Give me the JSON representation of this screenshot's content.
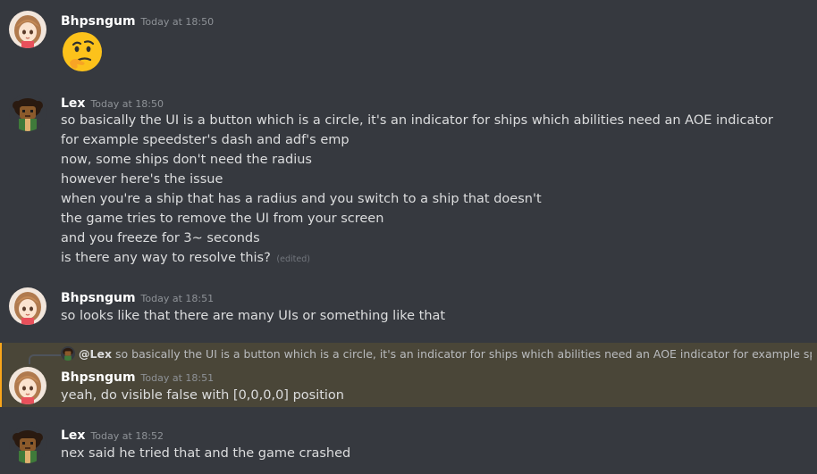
{
  "messages": [
    {
      "author": "Bhpsngum",
      "timestamp": "Today at 18:50",
      "emoji": "thinking-face"
    },
    {
      "author": "Lex",
      "timestamp": "Today at 18:50",
      "lines": [
        "so basically the UI is a button which is a circle, it's an indicator for ships which abilities need an AOE indicator",
        "for example speedster's dash and adf's emp",
        "now, some ships don't need the radius",
        "however here's the issue",
        "when you're a ship that has a radius and you switch to a ship that doesn't",
        "the game tries to remove the UI from your screen",
        "and you freeze for 3~ seconds",
        "is there any way to resolve this?"
      ],
      "edited_label": "(edited)"
    },
    {
      "author": "Bhpsngum",
      "timestamp": "Today at 18:51",
      "lines": [
        "so looks like that there are many UIs or something like that"
      ]
    },
    {
      "reply_to": {
        "mention": "@Lex",
        "preview": "so basically the UI is a button which is a circle, it's an indicator for ships which abilities need an AOE indicator for example speedster..."
      },
      "author": "Bhpsngum",
      "timestamp": "Today at 18:51",
      "lines": [
        "yeah, do visible false with [0,0,0,0] position"
      ],
      "highlight_color": "#4a4638"
    },
    {
      "author": "Lex",
      "timestamp": "Today at 18:52",
      "lines": [
        "nex said he tried that and the game crashed"
      ]
    }
  ]
}
